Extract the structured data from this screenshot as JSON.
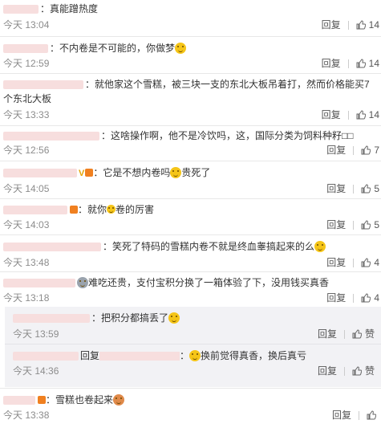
{
  "labels": {
    "reply": "回复",
    "colon": "："
  },
  "colors": {
    "accent": "#eb7350",
    "time": "#8c8c8c",
    "reply_bg": "#f2f2f5"
  },
  "comments": [
    {
      "text": "真能蹭热度",
      "time": "今天 13:04",
      "likes": "14"
    },
    {
      "text": "不内卷是不可能的，你做梦",
      "time": "今天 12:59",
      "likes": "14"
    },
    {
      "text": "就他家这个雪糕，被三块一支的东北大板吊着打，然而价格能买7个东北大板",
      "time": "今天 13:33",
      "likes": "14"
    },
    {
      "text": "这啥操作啊，他不是冷饮吗，这，国际分类为饲料种籽□□",
      "time": "今天 12:56",
      "likes": "7"
    },
    {
      "text": "它是不想内卷吗",
      "text2": "贵死了",
      "time": "今天 14:05",
      "likes": "5"
    },
    {
      "text": "就你",
      "text2": "卷的厉害",
      "time": "今天 14:03",
      "likes": "5"
    },
    {
      "text": "笑死了特码的雪糕内卷不就是终血睾搞起来的么",
      "time": "今天 13:48",
      "likes": "4"
    },
    {
      "text": "难吃还贵，支付宝积分换了一箱体验了下，没用钱买真香",
      "time": "今天 13:18",
      "likes": "4"
    },
    {
      "text": "雪糕也卷起来",
      "time": "今天 13:38",
      "likes": ""
    }
  ],
  "replies": [
    {
      "text": "把积分都搞丢了",
      "time": "今天 13:59",
      "like_label": "赞"
    },
    {
      "prefix": "回复",
      "text": "换前觉得真香，换后真亏",
      "time": "今天 14:36",
      "like_label": "赞"
    }
  ]
}
